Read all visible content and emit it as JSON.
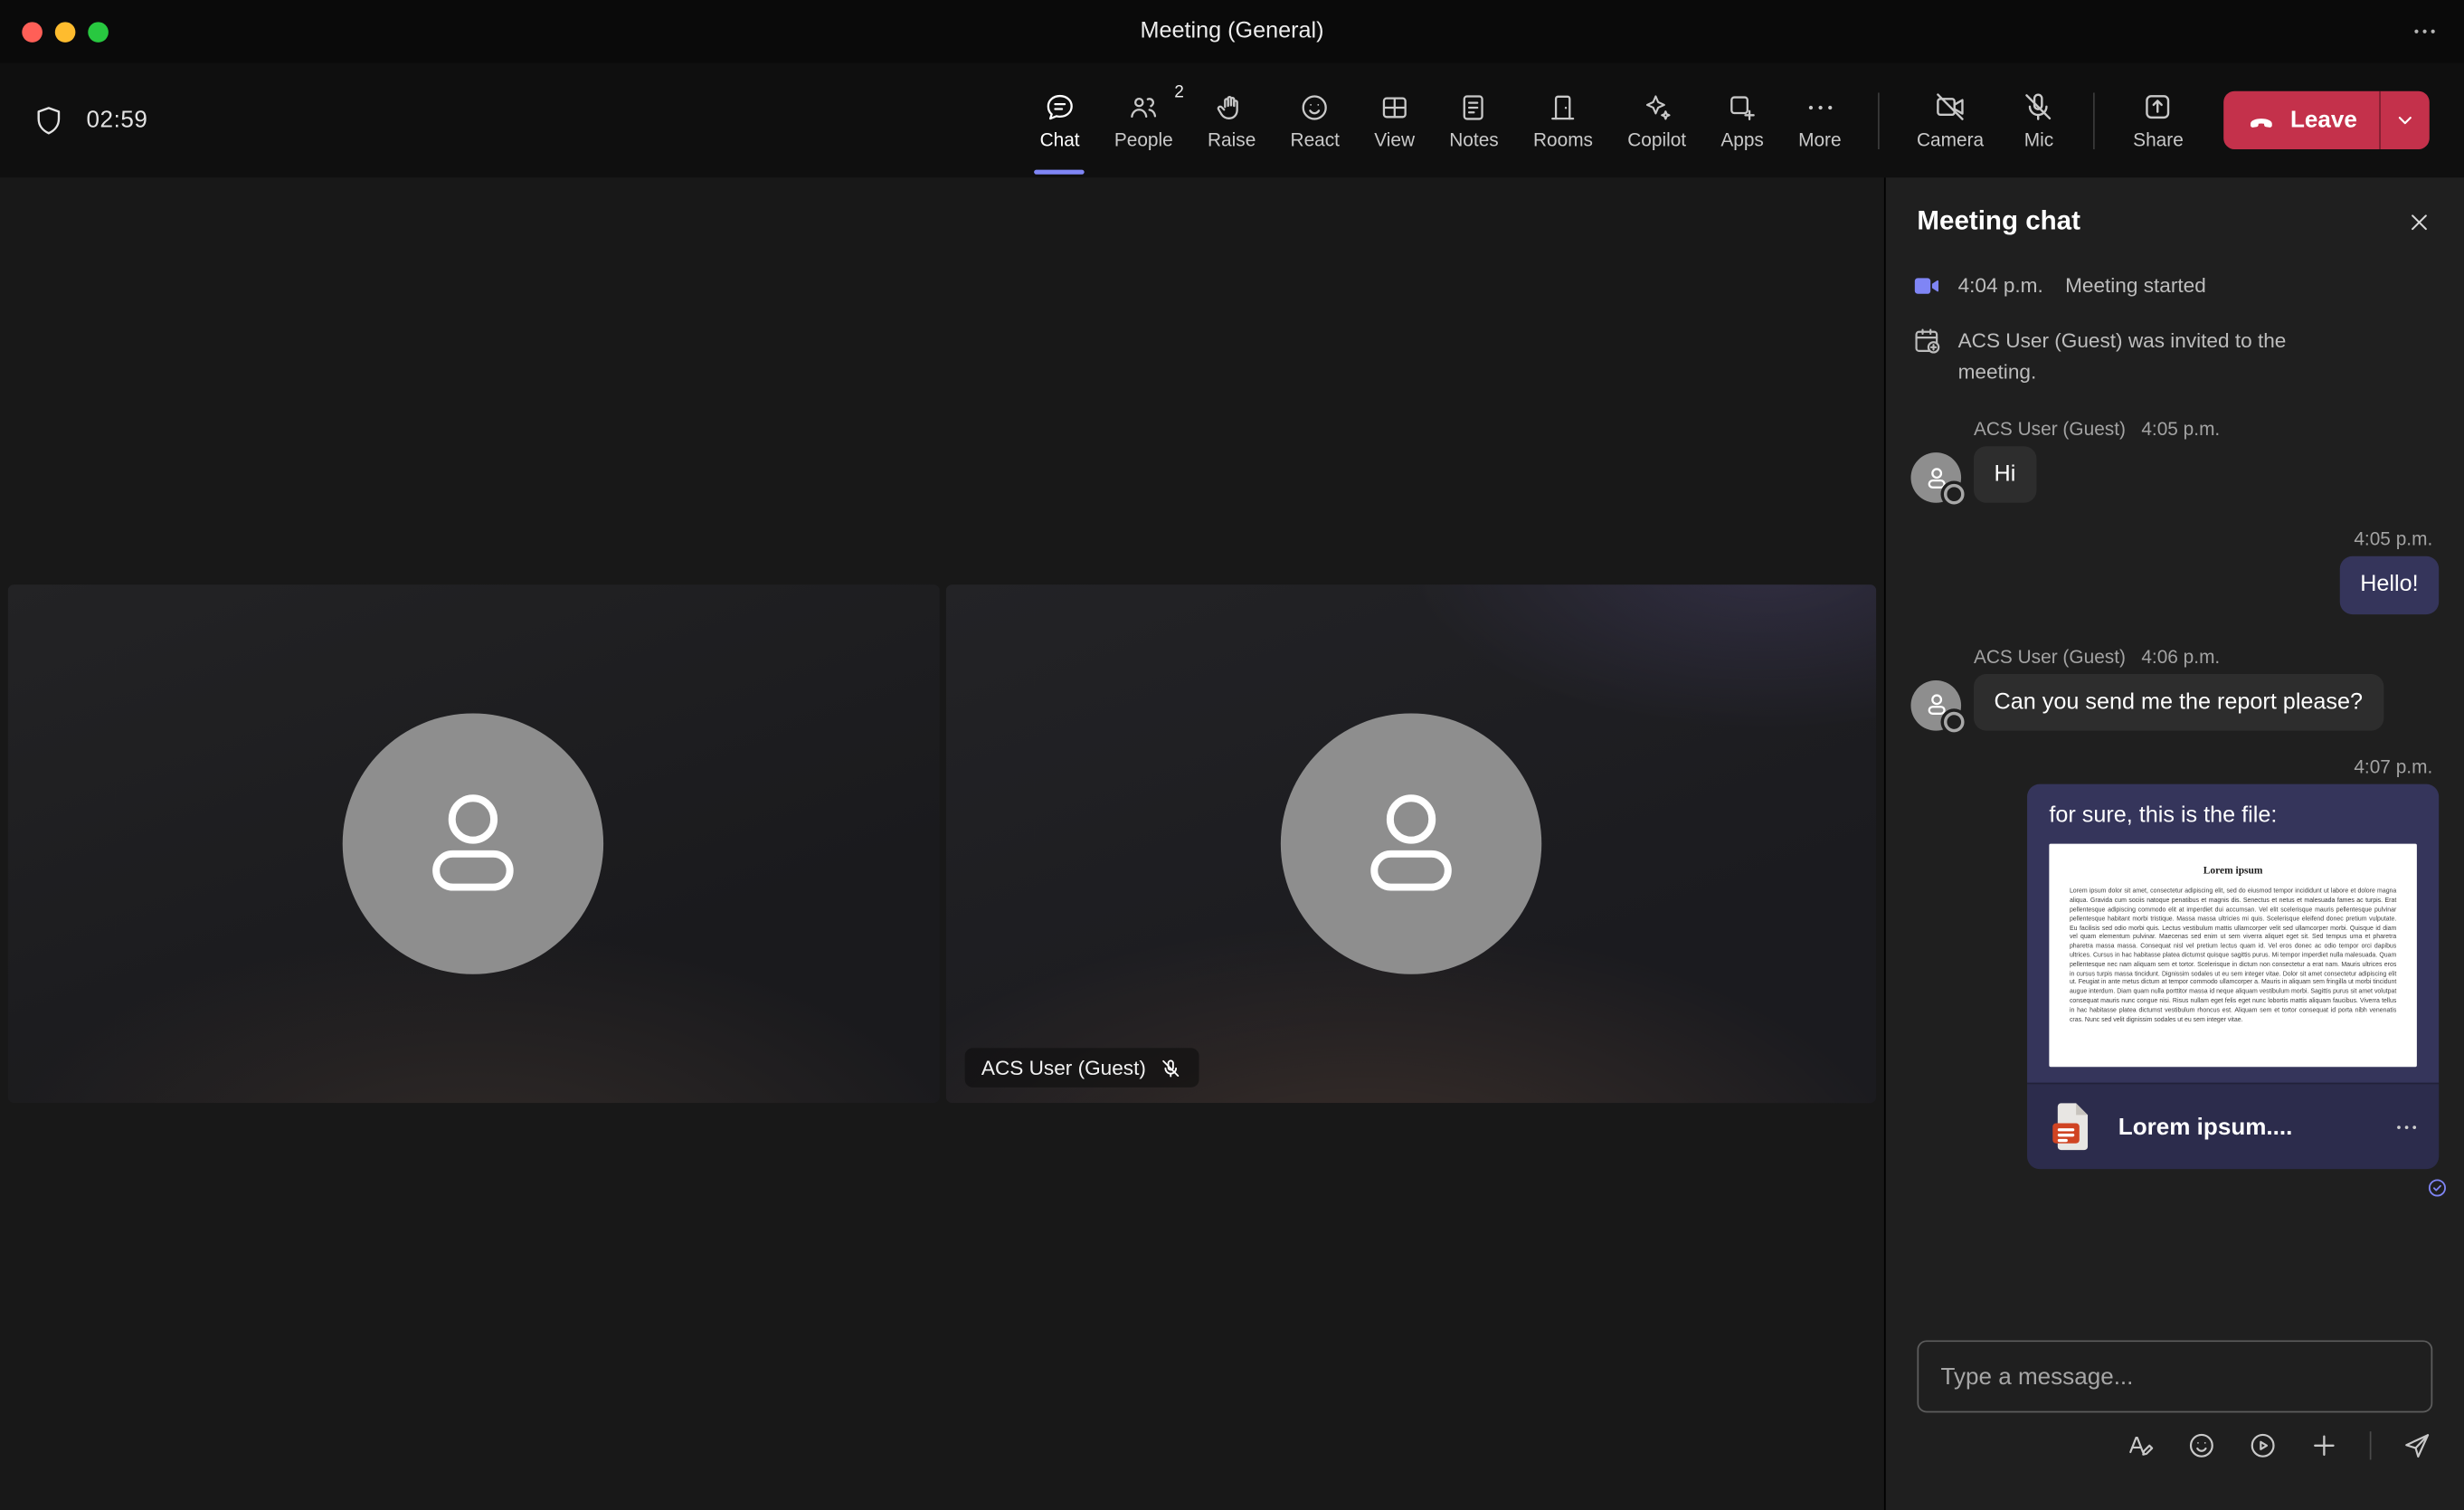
{
  "window": {
    "title": "Meeting (General)"
  },
  "toolbar": {
    "timer": "02:59",
    "tabs": [
      {
        "label": "Chat",
        "active": true
      },
      {
        "label": "People",
        "badge": "2"
      },
      {
        "label": "Raise"
      },
      {
        "label": "React"
      },
      {
        "label": "View"
      },
      {
        "label": "Notes"
      },
      {
        "label": "Rooms"
      },
      {
        "label": "Copilot"
      },
      {
        "label": "Apps"
      },
      {
        "label": "More"
      }
    ],
    "devices": [
      {
        "label": "Camera",
        "state": "off"
      },
      {
        "label": "Mic",
        "state": "off"
      },
      {
        "label": "Share"
      }
    ],
    "leave_label": "Leave"
  },
  "stage": {
    "tiles": [
      {
        "name_tag": ""
      },
      {
        "name_tag": "ACS User (Guest)",
        "muted": true
      }
    ]
  },
  "chat": {
    "title": "Meeting chat",
    "events": [
      {
        "time": "4:04 p.m.",
        "text": "Meeting started"
      },
      {
        "text": "ACS User (Guest) was invited to the meeting."
      }
    ],
    "messages": [
      {
        "author": "ACS User (Guest)",
        "time": "4:05 p.m.",
        "text": "Hi",
        "direction": "incoming"
      },
      {
        "time": "4:05 p.m.",
        "text": "Hello!",
        "direction": "outgoing"
      },
      {
        "author": "ACS User (Guest)",
        "time": "4:06 p.m.",
        "text": "Can you send me the report please?",
        "direction": "incoming"
      },
      {
        "time": "4:07 p.m.",
        "text": "for sure, this is the file:",
        "direction": "outgoing",
        "attachment": {
          "file_name": "Lorem ipsum....",
          "preview_heading": "Lorem ipsum",
          "preview_body": "Lorem ipsum dolor sit amet, consectetur adipiscing elit, sed do eiusmod tempor incididunt ut labore et dolore magna aliqua. Gravida cum sociis natoque penatibus et magnis dis. Senectus et netus et malesuada fames ac turpis. Erat pellentesque adipiscing commodo elit at imperdiet dui accumsan. Vel elit scelerisque mauris pellentesque pulvinar pellentesque habitant morbi tristique. Massa massa ultricies mi quis. Scelerisque eleifend donec pretium vulputate. Eu facilisis sed odio morbi quis. Lectus vestibulum mattis ullamcorper velit sed ullamcorper morbi. Quisque id diam vel quam elementum pulvinar. Maecenas sed enim ut sem viverra aliquet eget sit. Sed tempus urna et pharetra pharetra massa massa. Consequat nisl vel pretium lectus quam id. Vel eros donec ac odio tempor orci dapibus ultrices. Cursus in hac habitasse platea dictumst quisque sagittis purus. Mi tempor imperdiet nulla malesuada. Quam pellentesque nec nam aliquam sem et tortor. Scelerisque in dictum non consectetur a erat nam. Mauris ultrices eros in cursus turpis massa tincidunt. Dignissim sodales ut eu sem integer vitae. Dolor sit amet consectetur adipiscing elit ut. Feugiat in ante metus dictum at tempor commodo ullamcorper a. Mauris in aliquam sem fringilla ut morbi tincidunt augue interdum. Diam quam nulla porttitor massa id neque aliquam vestibulum morbi. Sagittis purus sit amet volutpat consequat mauris nunc congue nisi. Risus nullam eget felis eget nunc lobortis mattis aliquam faucibus. Viverra tellus in hac habitasse platea dictumst vestibulum rhoncus est. Aliquam sem et tortor consequat id porta nibh venenatis cras. Nunc sed velit dignissim sodales ut eu sem integer vitae."
        }
      }
    ],
    "compose": {
      "placeholder": "Type a message..."
    }
  },
  "colors": {
    "accent": "#7f85f5",
    "leave_red": "#c4314b",
    "bubble_incoming": "#2d2d2d",
    "bubble_outgoing": "#35355b",
    "panel_bg": "#1f1f1f",
    "traffic_lights": [
      "#ff5f57",
      "#febc2e",
      "#28c840"
    ],
    "file_icon_orange": "#d04423"
  }
}
